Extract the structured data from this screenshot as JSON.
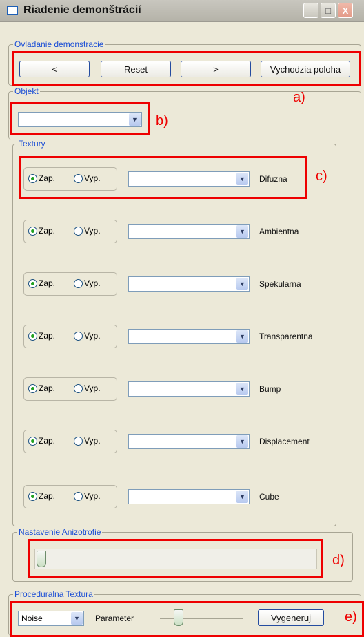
{
  "window": {
    "title": "Riadenie demonštrácií",
    "minimize": "_",
    "maximize": "□",
    "close": "X"
  },
  "demo_group": {
    "legend": "Ovladanie demonstracie",
    "prev": "<",
    "reset": "Reset",
    "next": ">",
    "default_pos": "Vychodzia poloha",
    "annot": "a)"
  },
  "object_group": {
    "legend": "Objekt",
    "annot": "b)"
  },
  "textures_group": {
    "legend": "Textury",
    "on_label": "Zap.",
    "off_label": "Vyp.",
    "annot": "c)",
    "rows": [
      {
        "name": "Difuzna"
      },
      {
        "name": "Ambientna"
      },
      {
        "name": "Spekularna"
      },
      {
        "name": "Transparentna"
      },
      {
        "name": "Bump"
      },
      {
        "name": "Displacement"
      },
      {
        "name": "Cube"
      }
    ]
  },
  "aniso_group": {
    "legend": "Nastavenie Anizotrofie",
    "annot": "d)",
    "level": 0
  },
  "proc_group": {
    "legend": "Proceduralna Textura",
    "noise": "Noise",
    "parameter": "Parameter",
    "generate": "Vygeneruj",
    "annot": "e)"
  }
}
